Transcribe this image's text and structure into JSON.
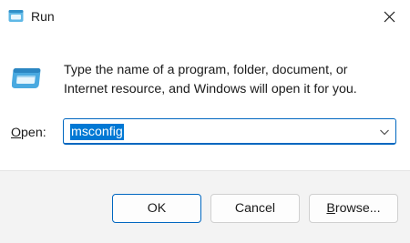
{
  "window": {
    "title": "Run",
    "icon": "run-icon",
    "close_icon": "close-icon"
  },
  "content": {
    "description_line1": "Type the name of a program, folder, document, or",
    "description_line2": "Internet resource, and Windows will open it for you.",
    "icon": "run-app-icon"
  },
  "open_field": {
    "label_accel": "O",
    "label_rest": "pen:",
    "value": "msconfig",
    "dropdown_icon": "chevron-down-icon"
  },
  "buttons": {
    "ok": "OK",
    "cancel": "Cancel",
    "browse_accel": "B",
    "browse_rest": "rowse..."
  },
  "colors": {
    "accent": "#0067c0",
    "selection": "#0078d4",
    "footer_bg": "#f3f3f3"
  }
}
